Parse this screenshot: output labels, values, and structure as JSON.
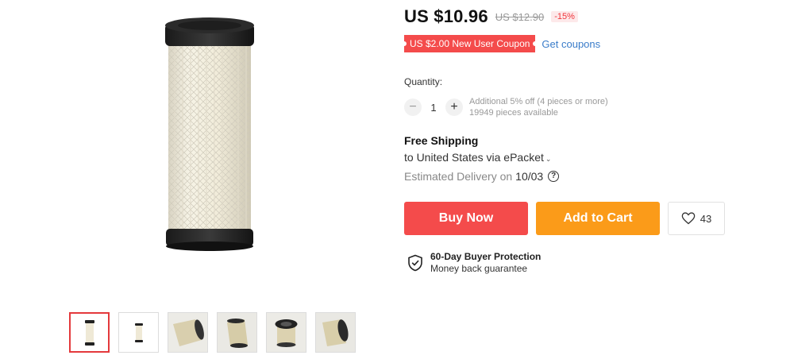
{
  "price": {
    "current": "US $10.96",
    "original": "US $12.90",
    "discount": "-15%"
  },
  "coupon": {
    "label": "US $2.00 New User Coupon",
    "link": "Get coupons"
  },
  "quantity": {
    "label": "Quantity:",
    "value": "1",
    "minus_icon": "minus-icon",
    "plus_icon": "plus-icon",
    "note_line1": "Additional 5% off (4 pieces or more)",
    "note_line2": "19949 pieces available"
  },
  "shipping": {
    "title": "Free Shipping",
    "destination": "to United States via ePacket",
    "delivery_label": "Estimated Delivery on",
    "delivery_date": "10/03"
  },
  "actions": {
    "buy_now": "Buy Now",
    "add_to_cart": "Add to Cart",
    "wishlist_count": "43"
  },
  "protection": {
    "title": "60-Day Buyer Protection",
    "subtitle": "Money back guarantee"
  },
  "gallery": {
    "thumbnails": [
      {
        "icon": "air-filter-front-thumb",
        "active": true
      },
      {
        "icon": "air-filter-small-thumb",
        "active": false
      },
      {
        "icon": "air-filter-side-thumb",
        "active": false
      },
      {
        "icon": "air-filter-angled-thumb",
        "active": false
      },
      {
        "icon": "air-filter-top-thumb",
        "active": false
      },
      {
        "icon": "air-filter-lying-thumb",
        "active": false
      }
    ]
  },
  "colors": {
    "accent_red": "#f44b4b",
    "accent_orange": "#fb9b19",
    "link_blue": "#3a7cc9"
  }
}
